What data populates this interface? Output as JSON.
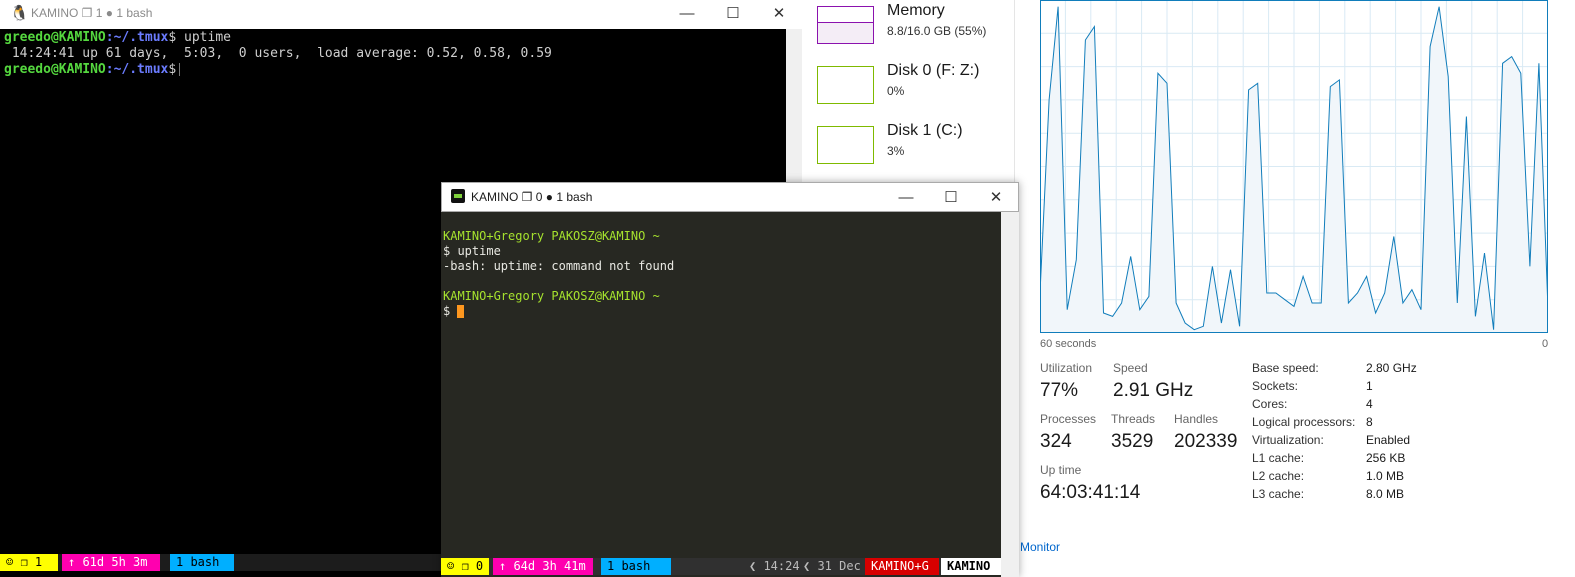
{
  "taskmgr": {
    "side_items": [
      {
        "name": "Memory",
        "sub": "8.8/16.0 GB (55%)"
      },
      {
        "name": "Disk 0 (F: Z:)",
        "sub": "0%"
      },
      {
        "name": "Disk 1 (C:)",
        "sub": "3%"
      }
    ],
    "graph": {
      "left_label": "60 seconds",
      "right_label": "0",
      "line_color": "#117dbb",
      "fill_color": "#f1f6fa",
      "grid_color": "#d9eaf4",
      "values": [
        12,
        70,
        98,
        7,
        22,
        88,
        92,
        6,
        5,
        9,
        23,
        7,
        11,
        78,
        75,
        9,
        3,
        1,
        2,
        20,
        3,
        19,
        2,
        73,
        75,
        12,
        12,
        10,
        8,
        17,
        9,
        9,
        74,
        76,
        9,
        12,
        17,
        6,
        12,
        29,
        9,
        13,
        7,
        86,
        98,
        77,
        9,
        65,
        5,
        24,
        1,
        81,
        83,
        78,
        20,
        81,
        7
      ]
    },
    "stats": {
      "utilization_label": "Utilization",
      "utilization_value": "77%",
      "speed_label": "Speed",
      "speed_value": "2.91 GHz",
      "processes_label": "Processes",
      "processes_value": "324",
      "threads_label": "Threads",
      "threads_value": "3529",
      "handles_label": "Handles",
      "handles_value": "202339",
      "uptime_label": "Up time",
      "uptime_value": "64:03:41:14"
    },
    "specs": [
      {
        "label": "Base speed:",
        "value": "2.80 GHz"
      },
      {
        "label": "Sockets:",
        "value": "1"
      },
      {
        "label": "Cores:",
        "value": "4"
      },
      {
        "label": "Logical processors:",
        "value": "8"
      },
      {
        "label": "Virtualization:",
        "value": "Enabled"
      },
      {
        "label": "L1 cache:",
        "value": "256 KB"
      },
      {
        "label": "L2 cache:",
        "value": "1.0 MB"
      },
      {
        "label": "L3 cache:",
        "value": "8.0 MB"
      }
    ],
    "resmon_link": "e Monitor"
  },
  "term1": {
    "title": "KAMINO ❐ 1 ● 1 bash",
    "icon": "linux-penguin-icon",
    "lines": [
      {
        "user": "greedo@KAMINO",
        "path": ":~/.tmux",
        "cmd": "$ uptime"
      },
      {
        "text": " 14:24:41 up 61 days,  5:03,  0 users,  load average: 0.52, 0.58, 0.59"
      },
      {
        "user": "greedo@KAMINO",
        "path": ":~/.tmux",
        "cmd": "$"
      }
    ],
    "status": {
      "session": "❐ 1",
      "uptime": "↑ 61d 5h 3m",
      "window": "1 bash",
      "colors": {
        "session_bg": "#ffff00",
        "uptime_bg": "#ff00af",
        "window_bg": "#00afff"
      }
    }
  },
  "term2": {
    "title": "KAMINO ❐ 0 ● 1 bash",
    "icon": "terminal-app-icon",
    "lines": [
      {
        "prompt": "KAMINO+Gregory PAKOSZ@KAMINO ~"
      },
      {
        "text": "$ uptime"
      },
      {
        "text": "-bash: uptime: command not found"
      },
      {
        "text": ""
      },
      {
        "prompt": "KAMINO+Gregory PAKOSZ@KAMINO ~"
      },
      {
        "text": "$ "
      }
    ],
    "status": {
      "session": "❐ 0",
      "uptime": "↑ 64d 3h 41m",
      "window": "1 bash",
      "time": "14:24",
      "date": "31 Dec",
      "user_host": "KAMINO+G",
      "host": "KAMINO",
      "colors": {
        "user_bg": "#d70000",
        "host_bg": "#ffffff"
      }
    }
  },
  "window_buttons": {
    "minimize": "—",
    "maximize": "☐",
    "close": "✕"
  }
}
